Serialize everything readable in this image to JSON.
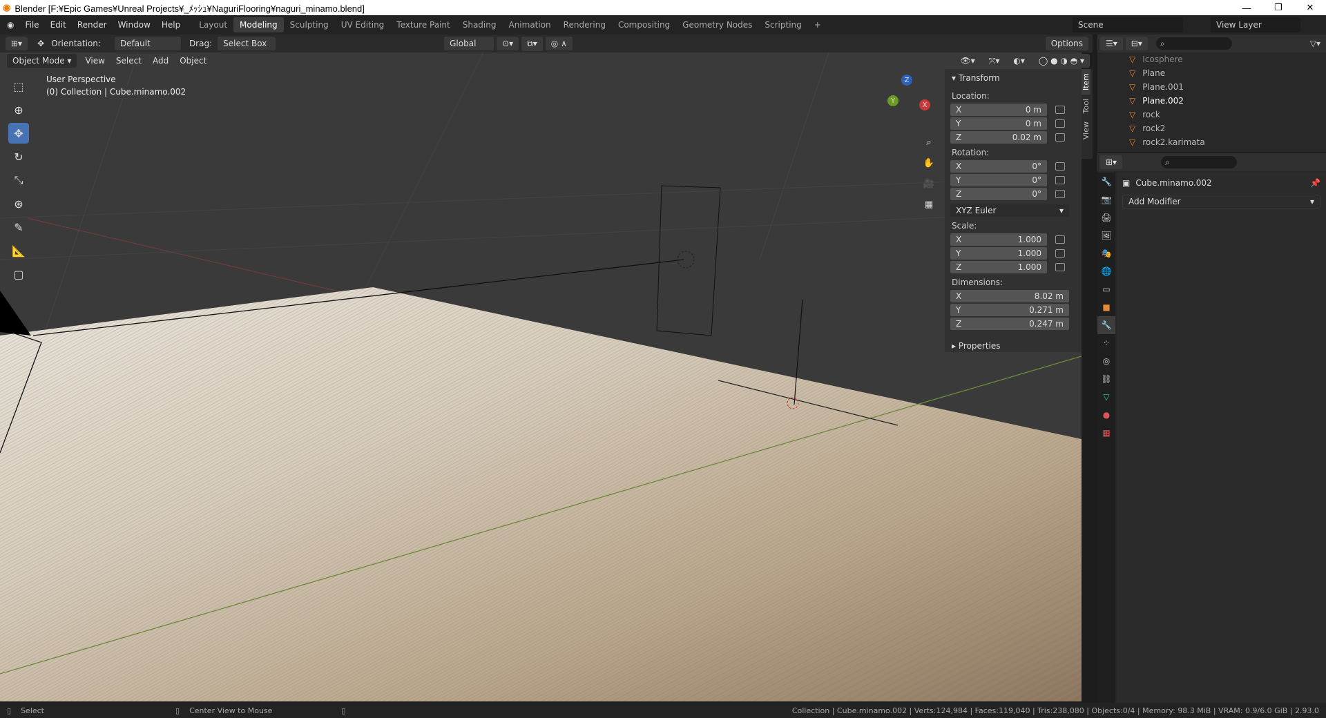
{
  "window": {
    "title": "Blender [F:¥Epic Games¥Unreal Projects¥_ﾒｯｼｭ¥NaguriFlooring¥naguri_minamo.blend]",
    "minimize": "—",
    "maximize": "❐",
    "close": "✕"
  },
  "menu": [
    "File",
    "Edit",
    "Render",
    "Window",
    "Help"
  ],
  "workspaces": [
    "Layout",
    "Modeling",
    "Sculpting",
    "UV Editing",
    "Texture Paint",
    "Shading",
    "Animation",
    "Rendering",
    "Compositing",
    "Geometry Nodes",
    "Scripting"
  ],
  "active_workspace": "Modeling",
  "scene": "Scene",
  "view_layer": "View Layer",
  "tool_header": {
    "orientation_label": "Orientation:",
    "orientation": "Default",
    "drag_label": "Drag:",
    "drag": "Select Box",
    "transform": "Global",
    "options": "Options"
  },
  "view_header": {
    "mode": "Object Mode",
    "items": [
      "View",
      "Select",
      "Add",
      "Object"
    ]
  },
  "viewport": {
    "perspective": "User Perspective",
    "collection": "(0) Collection | Cube.minamo.002"
  },
  "gizmo": {
    "x": "X",
    "y": "Y",
    "z": "Z"
  },
  "npanel": {
    "transform": "Transform",
    "location_label": "Location:",
    "location": [
      {
        "axis": "X",
        "value": "0 m"
      },
      {
        "axis": "Y",
        "value": "0 m"
      },
      {
        "axis": "Z",
        "value": "0.02 m"
      }
    ],
    "rotation_label": "Rotation:",
    "rotation": [
      {
        "axis": "X",
        "value": "0°"
      },
      {
        "axis": "Y",
        "value": "0°"
      },
      {
        "axis": "Z",
        "value": "0°"
      }
    ],
    "rotation_mode": "XYZ Euler",
    "scale_label": "Scale:",
    "scale": [
      {
        "axis": "X",
        "value": "1.000"
      },
      {
        "axis": "Y",
        "value": "1.000"
      },
      {
        "axis": "Z",
        "value": "1.000"
      }
    ],
    "dimensions_label": "Dimensions:",
    "dimensions": [
      {
        "axis": "X",
        "value": "8.02 m"
      },
      {
        "axis": "Y",
        "value": "0.271 m"
      },
      {
        "axis": "Z",
        "value": "0.247 m"
      }
    ],
    "properties": "Properties",
    "tabs": [
      "Item",
      "Tool",
      "View"
    ]
  },
  "outliner": [
    "Icosphere",
    "Plane",
    "Plane.001",
    "Plane.002",
    "rock",
    "rock2",
    "rock2.karimata"
  ],
  "properties_panel": {
    "object": "Cube.minamo.002",
    "add_modifier": "Add Modifier"
  },
  "status": {
    "left1": "Select",
    "left2": "Center View to Mouse",
    "right": "Collection | Cube.minamo.002 | Verts:124,984 | Faces:119,040 | Tris:238,080 | Objects:0/4 | Memory: 98.3 MiB | VRAM: 0.9/6.0 GiB | 2.93.0"
  }
}
